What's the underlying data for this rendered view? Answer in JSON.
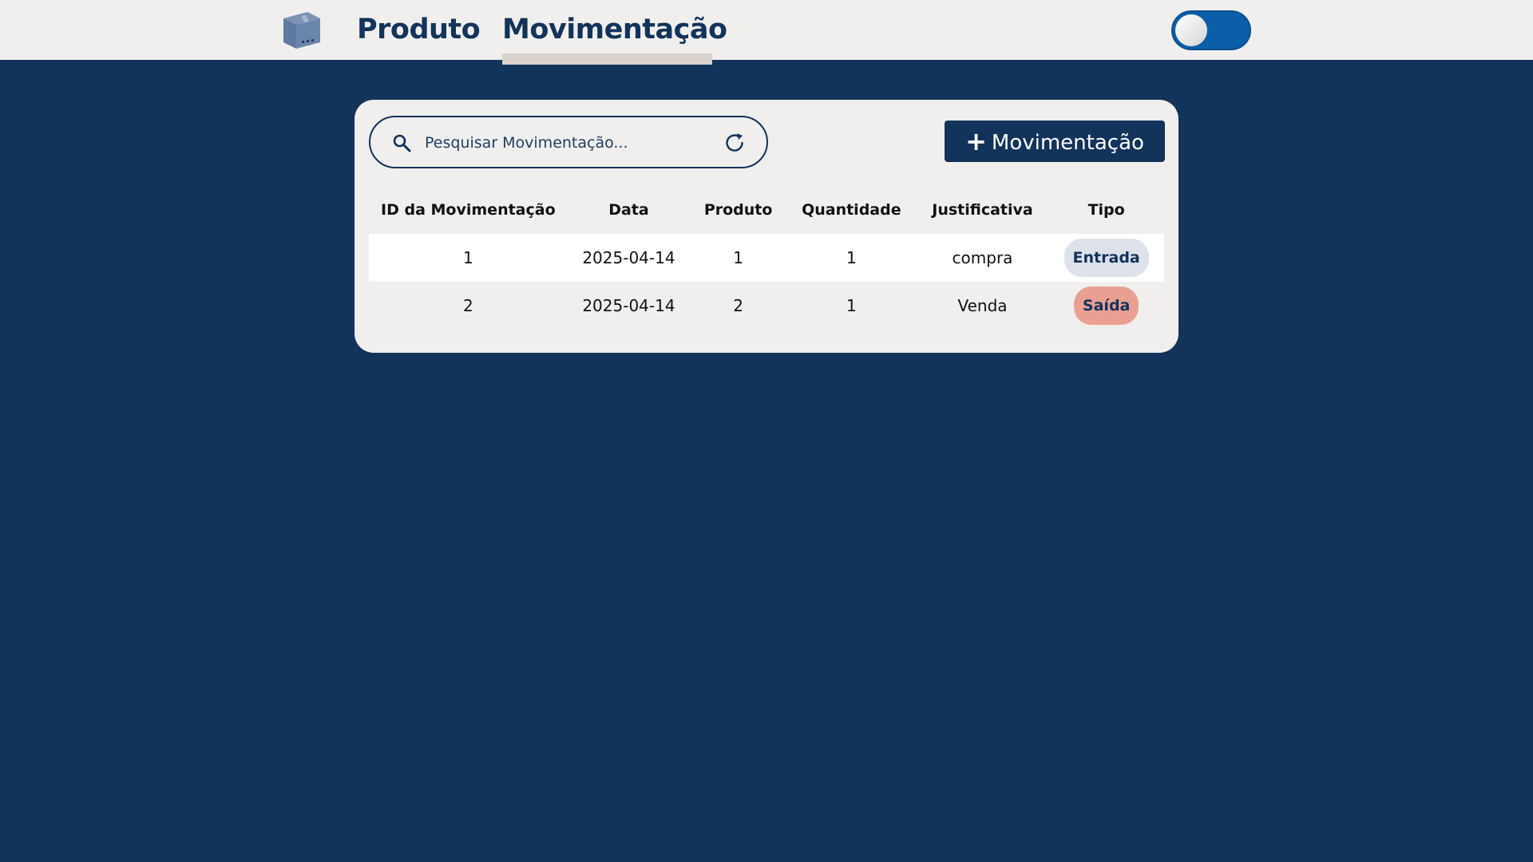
{
  "nav": {
    "items": [
      {
        "label": "Produto"
      },
      {
        "label": "Movimentação"
      }
    ],
    "active": "Movimentação",
    "logo_icon": "package-box-icon",
    "theme_toggle": {
      "state": "on",
      "accent": "#0a5fa8"
    }
  },
  "search": {
    "placeholder": "Pesquisar Movimentação...",
    "value": ""
  },
  "toolbar": {
    "add_label": "Movimentação",
    "add_icon": "+"
  },
  "table": {
    "columns": [
      "ID da Movimentação",
      "Data",
      "Produto",
      "Quantidade",
      "Justificativa",
      "Tipo"
    ],
    "rows": [
      {
        "id": "1",
        "data": "2025-04-14",
        "produto": "1",
        "quantidade": "1",
        "justificativa": "compra",
        "tipo": "Entrada"
      },
      {
        "id": "2",
        "data": "2025-04-14",
        "produto": "2",
        "quantidade": "1",
        "justificativa": "Venda",
        "tipo": "Saída"
      }
    ]
  },
  "colors": {
    "background": "#12335a",
    "surface": "#f0efed",
    "entrada_badge": "#dde2ea",
    "saida_badge": "#e9a092"
  }
}
